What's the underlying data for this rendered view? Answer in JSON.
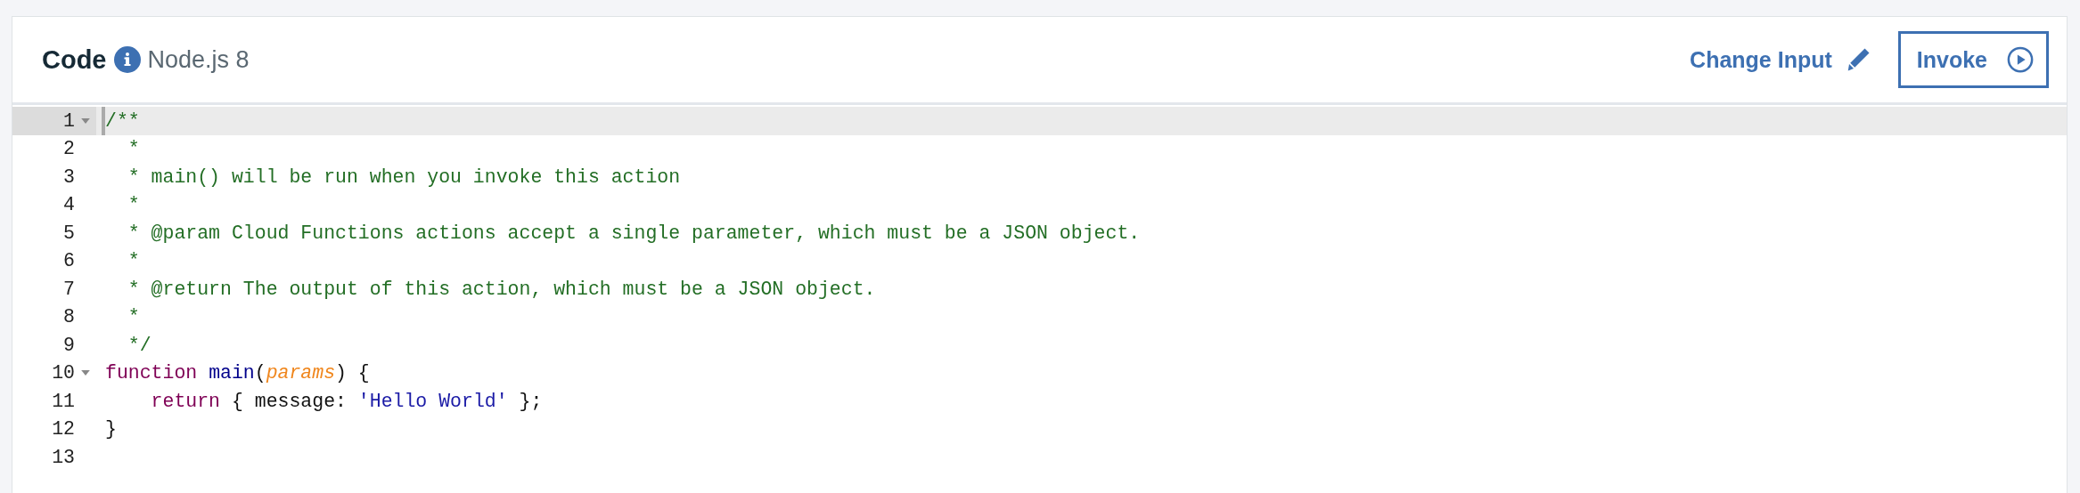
{
  "header": {
    "title": "Code",
    "runtime": "Node.js 8",
    "actions": [
      {
        "kind": "link",
        "label": "Change Input"
      },
      {
        "kind": "button",
        "label": "Invoke"
      }
    ]
  },
  "editor": {
    "lines": [
      {
        "number": "1",
        "foldable": true,
        "active": true,
        "tokens": [
          {
            "kind": "comment",
            "text": "/**"
          }
        ]
      },
      {
        "number": "2",
        "foldable": false,
        "active": false,
        "tokens": [
          {
            "kind": "comment",
            "text": "  *"
          }
        ]
      },
      {
        "number": "3",
        "foldable": false,
        "active": false,
        "tokens": [
          {
            "kind": "comment",
            "text": "  * main() will be run when you invoke this action"
          }
        ]
      },
      {
        "number": "4",
        "foldable": false,
        "active": false,
        "tokens": [
          {
            "kind": "comment",
            "text": "  *"
          }
        ]
      },
      {
        "number": "5",
        "foldable": false,
        "active": false,
        "tokens": [
          {
            "kind": "comment",
            "text": "  * @param Cloud Functions actions accept a single parameter, which must be a JSON object."
          }
        ]
      },
      {
        "number": "6",
        "foldable": false,
        "active": false,
        "tokens": [
          {
            "kind": "comment",
            "text": "  *"
          }
        ]
      },
      {
        "number": "7",
        "foldable": false,
        "active": false,
        "tokens": [
          {
            "kind": "comment",
            "text": "  * @return The output of this action, which must be a JSON object."
          }
        ]
      },
      {
        "number": "8",
        "foldable": false,
        "active": false,
        "tokens": [
          {
            "kind": "comment",
            "text": "  *"
          }
        ]
      },
      {
        "number": "9",
        "foldable": false,
        "active": false,
        "tokens": [
          {
            "kind": "comment",
            "text": "  */"
          }
        ]
      },
      {
        "number": "10",
        "foldable": true,
        "active": false,
        "tokens": [
          {
            "kind": "keyword",
            "text": "function "
          },
          {
            "kind": "def",
            "text": "main"
          },
          {
            "kind": "plain",
            "text": "("
          },
          {
            "kind": "param",
            "text": "params"
          },
          {
            "kind": "plain",
            "text": ") {"
          }
        ]
      },
      {
        "number": "11",
        "foldable": false,
        "active": false,
        "tokens": [
          {
            "kind": "keyword",
            "text": "    return"
          },
          {
            "kind": "plain",
            "text": " { message: "
          },
          {
            "kind": "string",
            "text": "'Hello World'"
          },
          {
            "kind": "plain",
            "text": " };"
          }
        ]
      },
      {
        "number": "12",
        "foldable": false,
        "active": false,
        "tokens": [
          {
            "kind": "plain",
            "text": "}"
          }
        ]
      },
      {
        "number": "13",
        "foldable": false,
        "active": false
      }
    ]
  }
}
